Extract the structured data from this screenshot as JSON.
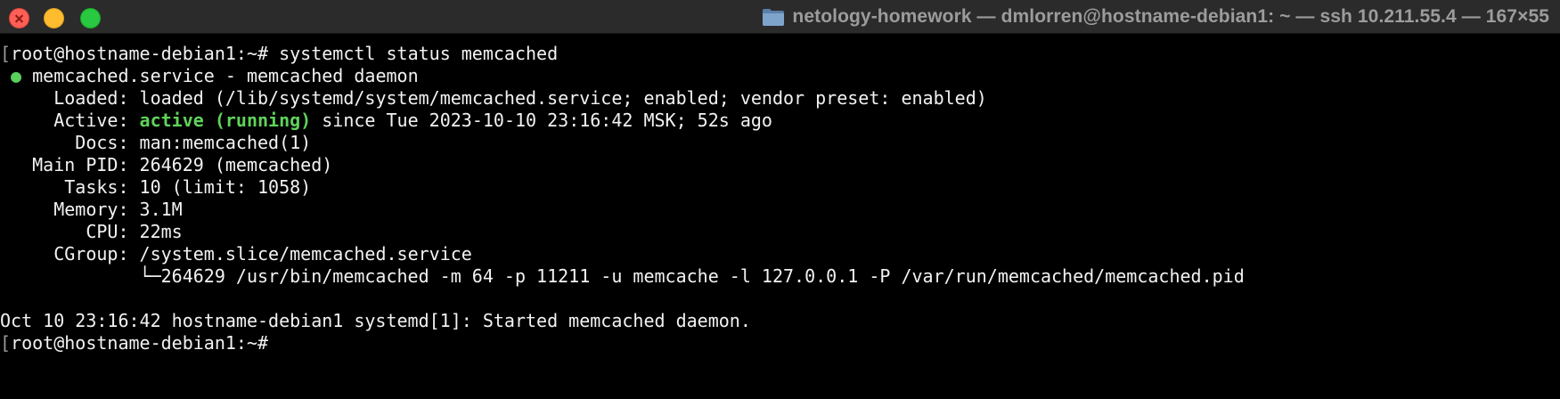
{
  "window": {
    "title": "netology-homework — dmlorren@hostname-debian1: ~ — ssh 10.211.55.4 — 167×55",
    "folder_icon": "folder-icon",
    "controls": {
      "close": "close-button",
      "minimize": "minimize-button",
      "zoom": "zoom-button"
    },
    "colors": {
      "close": "#ff5f57",
      "minimize": "#febc2e",
      "zoom": "#28c840",
      "active_status": "#5fd35a",
      "background": "#000000",
      "text": "#f2f2f2"
    }
  },
  "terminal": {
    "prompt": "root@hostname-debian1:~#",
    "command": " systemctl status memcached",
    "status_dot": "●",
    "service_header": " memcached.service - memcached daemon",
    "loaded_label": "     Loaded:",
    "loaded_value": " loaded (/lib/systemd/system/memcached.service; enabled; vendor preset: enabled)",
    "active_label": "     Active:",
    "active_state": " active (running)",
    "active_since": " since Tue 2023-10-10 23:16:42 MSK; 52s ago",
    "docs_label": "       Docs:",
    "docs_value": " man:memcached(1)",
    "mainpid_label": "   Main PID:",
    "mainpid_value": " 264629 (memcached)",
    "tasks_label": "      Tasks:",
    "tasks_value": " 10 (limit: 1058)",
    "memory_label": "     Memory:",
    "memory_value": " 3.1M",
    "cpu_label": "        CPU:",
    "cpu_value": " 22ms",
    "cgroup_label": "     CGroup:",
    "cgroup_value": " /system.slice/memcached.service",
    "process_line": "             └─264629 /usr/bin/memcached -m 64 -p 11211 -u memcache -l 127.0.0.1 -P /var/run/memcached/memcached.pid",
    "log_line": "Oct 10 23:16:42 hostname-debian1 systemd[1]: Started memcached daemon.",
    "final_prompt": "root@hostname-debian1:~#"
  }
}
